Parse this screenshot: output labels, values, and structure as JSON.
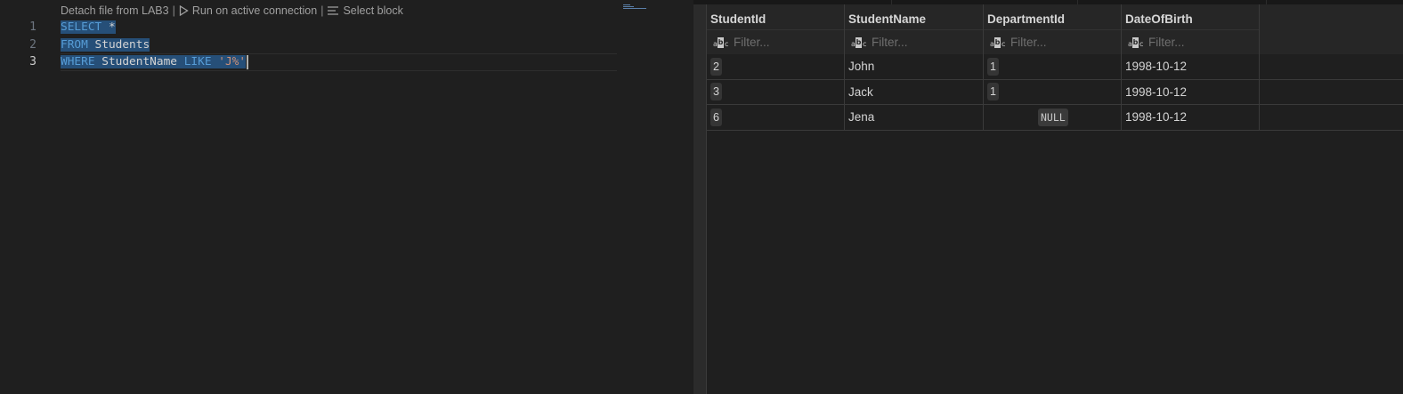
{
  "codelens": {
    "detach": "Detach file from LAB3",
    "run": "Run on active connection",
    "select_block": "Select block",
    "separator": "|"
  },
  "editor": {
    "line_numbers": [
      "1",
      "2",
      "3"
    ],
    "active_line": 3,
    "lines": [
      {
        "tokens": [
          {
            "t": "SELECT",
            "c": "kw"
          },
          {
            "t": " *",
            "c": ""
          }
        ]
      },
      {
        "tokens": [
          {
            "t": "FROM",
            "c": "kw"
          },
          {
            "t": " Students",
            "c": ""
          }
        ]
      },
      {
        "tokens": [
          {
            "t": "WHERE",
            "c": "kw"
          },
          {
            "t": " StudentName ",
            "c": ""
          },
          {
            "t": "LIKE",
            "c": "kw"
          },
          {
            "t": " ",
            "c": ""
          },
          {
            "t": "'J%'",
            "c": "str"
          }
        ]
      }
    ]
  },
  "results": {
    "columns": [
      "StudentId",
      "StudentName",
      "DepartmentId",
      "DateOfBirth"
    ],
    "filter_placeholder": "Filter...",
    "rows": [
      [
        "2",
        "John",
        "1",
        "1998-10-12"
      ],
      [
        "3",
        "Jack",
        "1",
        "1998-10-12"
      ],
      [
        "6",
        "Jena",
        "NULL",
        "1998-10-12"
      ]
    ]
  },
  "colors": {
    "keyword": "#569cd6",
    "string": "#ce9178",
    "selection": "#264f78",
    "background": "#1f1f1f"
  }
}
